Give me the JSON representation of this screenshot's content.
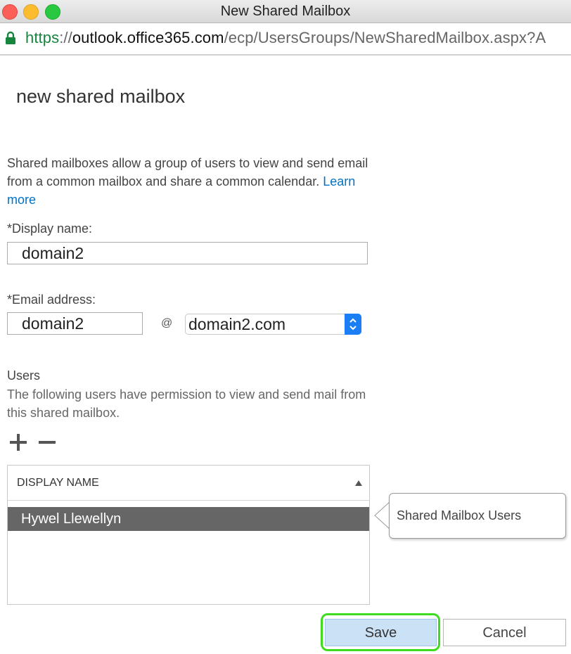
{
  "window": {
    "title": "New Shared Mailbox",
    "url": {
      "scheme": "https",
      "separator": "://",
      "host": "outlook.office365.com",
      "path": "/ecp/UsersGroups/NewSharedMailbox.aspx?A"
    }
  },
  "form": {
    "heading": "new shared mailbox",
    "description": "Shared mailboxes allow a group of users to view and send email from a common mailbox and share a common calendar.",
    "learn_more": "Learn more",
    "display_name_label": "*Display name:",
    "display_name_value": "domain2",
    "email_label": "*Email address:",
    "email_alias_value": "domain2",
    "at_symbol": "@",
    "domain_value": "domain2.com"
  },
  "users": {
    "title": "Users",
    "description": "The following users have permission to view and send mail from this shared mailbox.",
    "column_header": "DISPLAY NAME",
    "rows": [
      "Hywel Llewellyn"
    ],
    "callout": "Shared Mailbox Users"
  },
  "actions": {
    "save": "Save",
    "cancel": "Cancel"
  },
  "colors": {
    "link": "#0072c6",
    "url_scheme": "#16863f",
    "selected_row": "#666666",
    "save_button": "#cbe2f6",
    "highlight": "#3ddc1f"
  }
}
